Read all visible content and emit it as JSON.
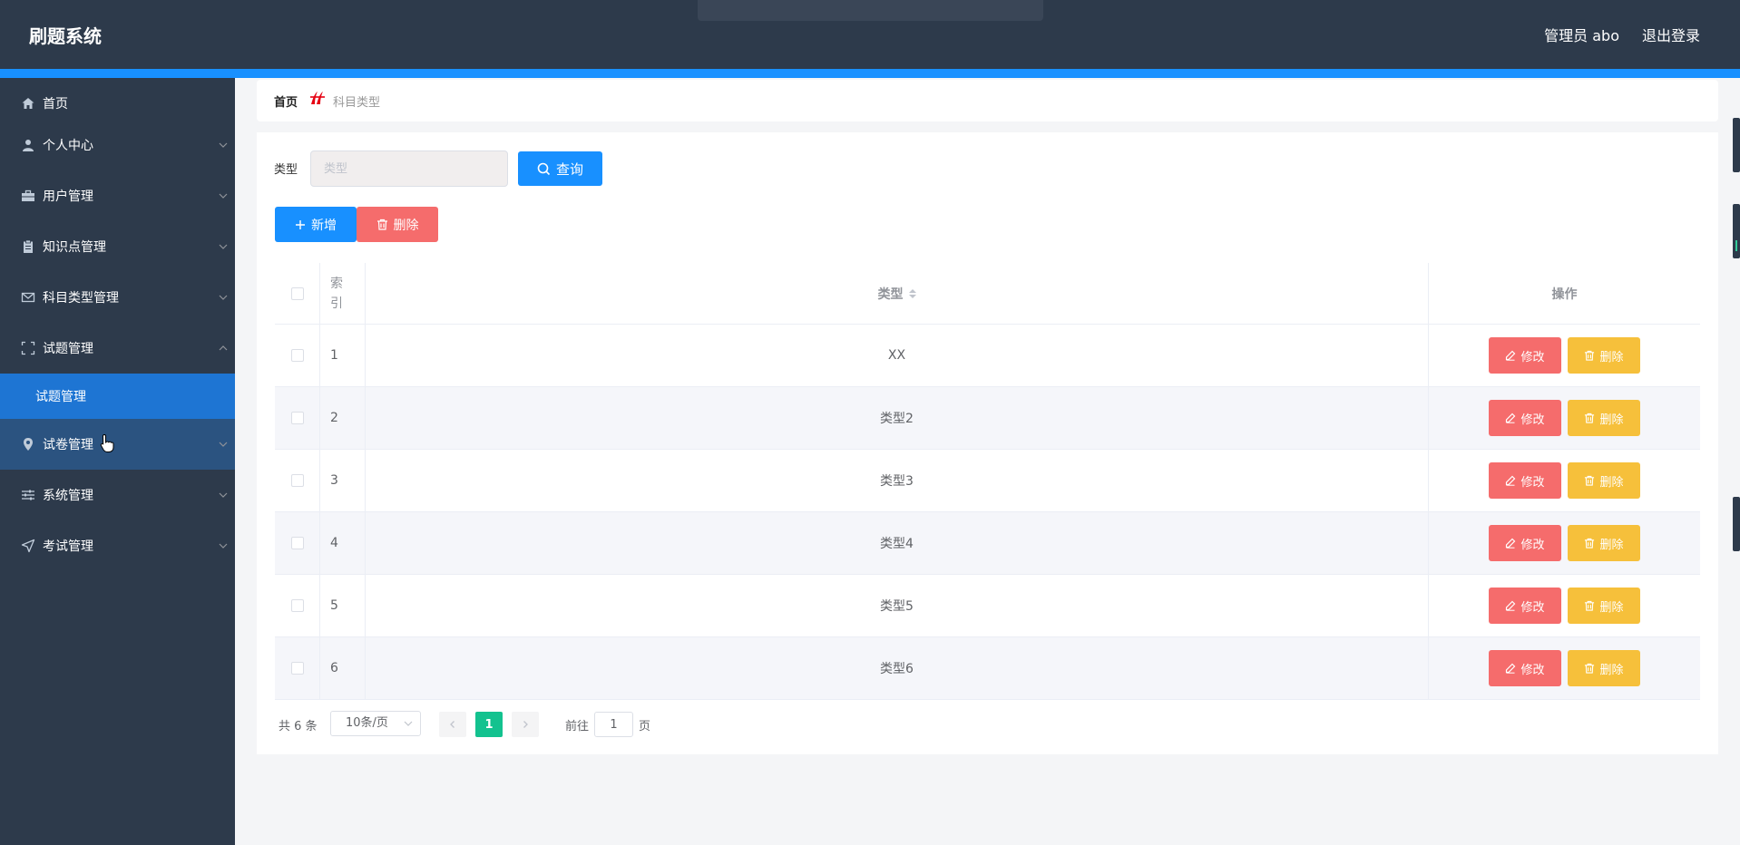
{
  "app": {
    "title": "刷题系统"
  },
  "header": {
    "user": "管理员 abo",
    "logout": "退出登录"
  },
  "sidebar": {
    "items": [
      {
        "label": "首页",
        "icon": "home-icon"
      },
      {
        "label": "个人中心",
        "icon": "user-icon"
      },
      {
        "label": "用户管理",
        "icon": "briefcase-icon"
      },
      {
        "label": "知识点管理",
        "icon": "clipboard-icon"
      },
      {
        "label": "科目类型管理",
        "icon": "mail-icon"
      },
      {
        "label": "试题管理",
        "icon": "fullscreen-icon",
        "expanded": true
      },
      {
        "label": "试题管理",
        "submenu": true,
        "active": true
      },
      {
        "label": "试卷管理",
        "icon": "location-icon",
        "hovered": true
      },
      {
        "label": "系统管理",
        "icon": "sliders-icon"
      },
      {
        "label": "考试管理",
        "icon": "send-icon"
      }
    ]
  },
  "breadcrumb": {
    "home": "首页",
    "current": "科目类型"
  },
  "search": {
    "label": "类型",
    "placeholder": "类型",
    "button": "查询"
  },
  "toolbar": {
    "add": "新增",
    "delete": "删除"
  },
  "table": {
    "headers": {
      "index": [
        "索",
        "引"
      ],
      "type": "类型",
      "actions": "操作"
    },
    "rows": [
      {
        "index": "1",
        "type": "XX"
      },
      {
        "index": "2",
        "type": "类型2"
      },
      {
        "index": "3",
        "type": "类型3"
      },
      {
        "index": "4",
        "type": "类型4"
      },
      {
        "index": "5",
        "type": "类型5"
      },
      {
        "index": "6",
        "type": "类型6"
      }
    ],
    "edit_label": "修改",
    "delete_label": "删除"
  },
  "pagination": {
    "total": "共 6 条",
    "page_size": "10条/页",
    "current_page": "1",
    "goto_prefix": "前往",
    "goto_value": "1",
    "goto_suffix": "页"
  },
  "colors": {
    "header_bg": "#2d3a4b",
    "accent": "#1890ff",
    "danger": "#f56c6c",
    "warning": "#f6c03b",
    "page_active": "#13c28f"
  }
}
